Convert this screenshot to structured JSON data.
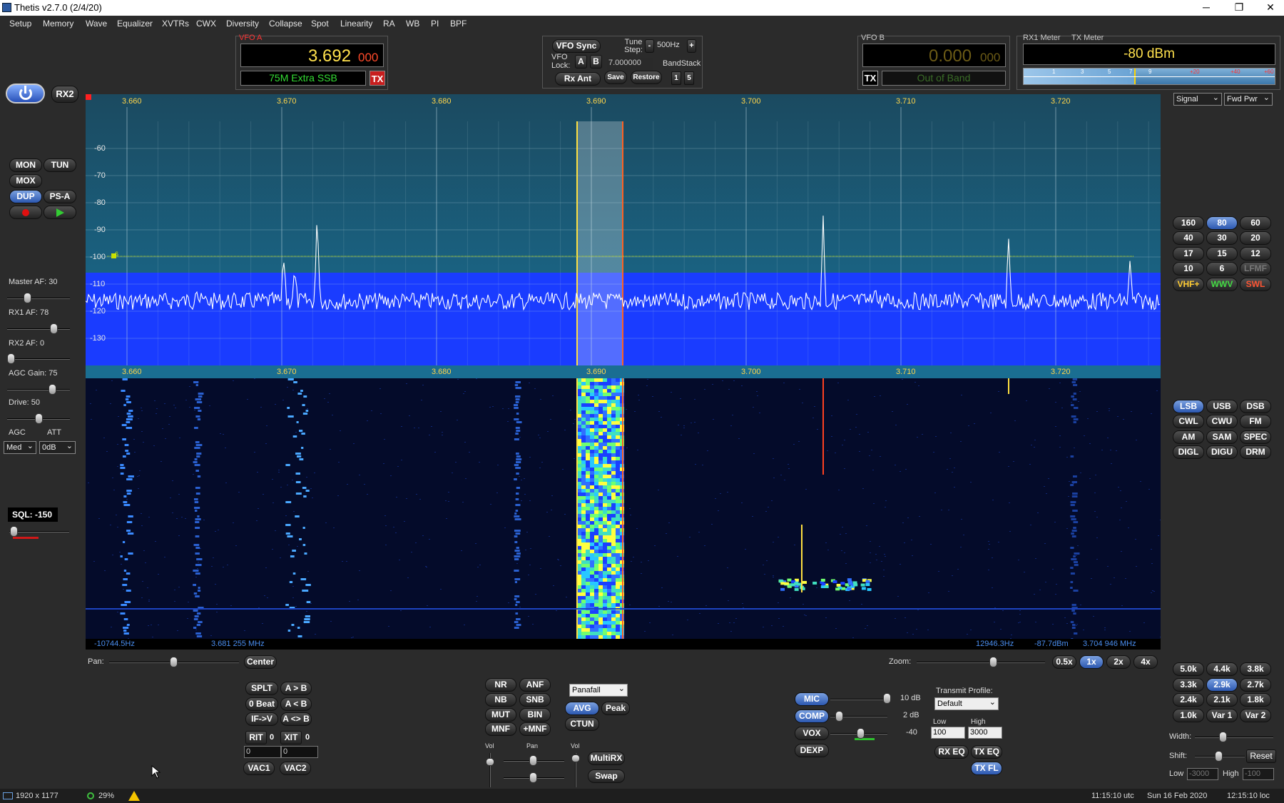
{
  "window": {
    "title": "Thetis v2.7.0 (2/4/20)",
    "min": "─",
    "max": "❐",
    "close": "✕"
  },
  "menu": [
    "Setup",
    "Memory",
    "Wave",
    "Equalizer",
    "XVTRs",
    "CWX",
    "Diversity",
    "Collapse",
    "Spot",
    "Linearity",
    "RA",
    "WB",
    "PI",
    "BPF"
  ],
  "vfoa": {
    "label": "VFO A",
    "freq_main": "3.692",
    "freq_sub": "000",
    "band_text": "75M Extra SSB",
    "tx": "TX"
  },
  "vfosync": {
    "sync": "VFO Sync",
    "tune_step_label": "Tune Step:",
    "step_minus": "-",
    "step_value": "500Hz",
    "step_plus": "+",
    "lock_label": "VFO Lock:",
    "lock_a": "A",
    "lock_b": "B",
    "freq_field": "7.000000",
    "bandstack": "BandStack",
    "rx_ant": "Rx Ant",
    "save": "Save",
    "restore": "Restore",
    "bs_index": "1",
    "bs_count": "5"
  },
  "vfob": {
    "label": "VFO B",
    "freq_main": "0.000",
    "freq_sub": "000",
    "tx": "TX",
    "band_text": "Out of Band"
  },
  "meter": {
    "rx_label": "RX1 Meter",
    "tx_label": "TX Meter",
    "reading": "-80 dBm",
    "scale": [
      "1",
      "3",
      "5",
      "7",
      "9",
      "+20",
      "+40",
      "+60"
    ],
    "rx_select": "Signal",
    "tx_select": "Fwd Pwr",
    "level_fraction": 0.44
  },
  "left": {
    "rx2": "RX2",
    "mon": "MON",
    "tun": "TUN",
    "mox": "MOX",
    "dup": "DUP",
    "psa": "PS-A",
    "master_af": "Master AF:  30",
    "master_af_v": 30,
    "rx1_af": "RX1 AF:  78",
    "rx1_af_v": 78,
    "rx2_af": "RX2 AF:  0",
    "rx2_af_v": 0,
    "agc_gain": "AGC Gain:  75",
    "agc_gain_v": 75,
    "drive": "Drive:  50",
    "drive_v": 50,
    "agc_label": "AGC",
    "att_label": "ATT",
    "agc_value": "Med",
    "att_value": "0dB",
    "sql": "SQL: -150"
  },
  "panadapter": {
    "freq_ticks": [
      "3.660",
      "3.670",
      "3.680",
      "3.690",
      "3.700",
      "3.710",
      "3.720"
    ],
    "db_ticks": [
      "-60",
      "-70",
      "-80",
      "-90",
      "-100",
      "-110",
      "-120",
      "-130"
    ],
    "marker": "-6"
  },
  "waterfall_info": {
    "left_offset": "-10744.5Hz",
    "left_freq": "3.681 255 MHz",
    "right_offset": "12946.3Hz",
    "right_db": "-87.7dBm",
    "right_freq": "3.704 946 MHz"
  },
  "pan_zoom": {
    "pan_label": "Pan:",
    "center": "Center",
    "zoom_label": "Zoom:",
    "z05": "0.5x",
    "z1": "1x",
    "z2": "2x",
    "z4": "4x"
  },
  "split": {
    "splt": "SPLT",
    "atob": "A > B",
    "zerobeat": "0 Beat",
    "btoa": "A < B",
    "ifv": "IF->V",
    "swap": "A <> B",
    "rit": "RIT",
    "rit_v": "0",
    "xit": "XIT",
    "xit_v": "0",
    "rit_field": "0",
    "xit_field": "0",
    "vac1": "VAC1",
    "vac2": "VAC2"
  },
  "dsp": {
    "nr": "NR",
    "anf": "ANF",
    "nb": "NB",
    "snb": "SNB",
    "mut": "MUT",
    "bin": "BIN",
    "mnf": "MNF",
    "pmnf": "+MNF",
    "display_mode": "Panafall",
    "avg": "AVG",
    "peak": "Peak",
    "ctun": "CTUN",
    "vol1": "Vol",
    "pan": "Pan",
    "vol2": "Vol",
    "multirx": "MultiRX",
    "swap": "Swap"
  },
  "tx": {
    "mic": "MIC",
    "mic_db": "10 dB",
    "comp": "COMP",
    "comp_db": "2 dB",
    "vox": "VOX",
    "vox_v": "-40",
    "dexp": "DEXP",
    "profile_label": "Transmit Profile:",
    "profile": "Default",
    "low_label": "Low",
    "high_label": "High",
    "low": "100",
    "high": "3000",
    "rxeq": "RX EQ",
    "txeq": "TX EQ",
    "txfl": "TX FL"
  },
  "bands": [
    "160",
    "80",
    "60",
    "40",
    "30",
    "20",
    "17",
    "15",
    "12",
    "10",
    "6",
    "LFMF",
    "VHF+",
    "WWV",
    "SWL"
  ],
  "modes": [
    "LSB",
    "USB",
    "DSB",
    "CWL",
    "CWU",
    "FM",
    "AM",
    "SAM",
    "SPEC",
    "DIGL",
    "DIGU",
    "DRM"
  ],
  "filters": [
    "5.0k",
    "4.4k",
    "3.8k",
    "3.3k",
    "2.9k",
    "2.7k",
    "2.4k",
    "2.1k",
    "1.8k",
    "1.0k",
    "Var 1",
    "Var 2"
  ],
  "filter_ctrl": {
    "width": "Width:",
    "shift": "Shift:",
    "reset": "Reset",
    "low": "Low",
    "low_v": "-3000",
    "high": "High",
    "high_v": "-100"
  },
  "status": {
    "resolution": "1920 x 1177",
    "cpu": "29%",
    "utc": "11:15:10 utc",
    "date": "Sun 16 Feb 2020",
    "local": "12:15:10 loc"
  },
  "colors": {
    "accent_on": "#3a6cc8",
    "freq_yellow": "#ffe14d",
    "band_green": "#33dd33",
    "pan_blue": "#1a3cff"
  }
}
